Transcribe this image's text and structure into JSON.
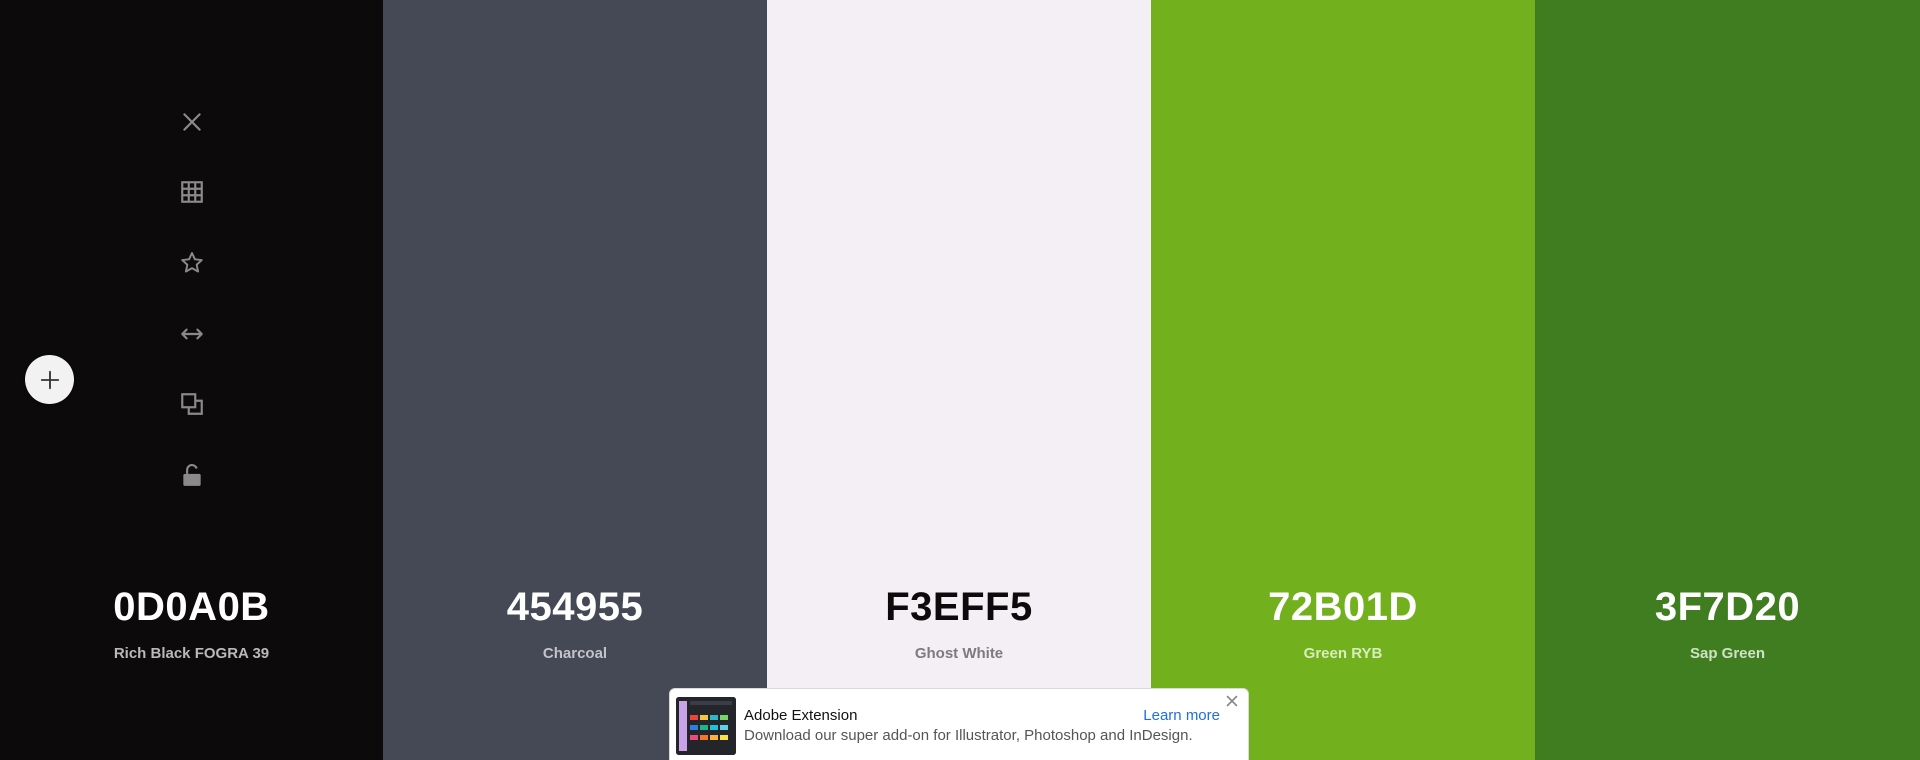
{
  "swatches": [
    {
      "hex": "0D0A0B",
      "name": "Rich Black FOGRA 39",
      "color": "#0d0a0b",
      "text_color": "#ffffff",
      "name_color": "#b9b9b9"
    },
    {
      "hex": "454955",
      "name": "Charcoal",
      "color": "#454955",
      "text_color": "#ffffff",
      "name_color": "#c2c4ca"
    },
    {
      "hex": "F3EFF5",
      "name": "Ghost White",
      "color": "#f3eff5",
      "text_color": "#0d0a0b",
      "name_color": "#7d7a80"
    },
    {
      "hex": "72B01D",
      "name": "Green RYB",
      "color": "#72b01d",
      "text_color": "#ffffff",
      "name_color": "#d8ecbe"
    },
    {
      "hex": "3F7D20",
      "name": "Sap Green",
      "color": "#3f7d20",
      "text_color": "#ffffff",
      "name_color": "#cfe2c6"
    }
  ],
  "tool_icons": [
    "close-icon",
    "grid-icon",
    "star-icon",
    "arrows-horizontal-icon",
    "copy-icon",
    "unlock-icon"
  ],
  "add_button": {
    "icon": "plus-icon"
  },
  "ad": {
    "title": "Adobe Extension",
    "description": "Download our super add-on for Illustrator, Photoshop and InDesign.",
    "link": "Learn more"
  }
}
